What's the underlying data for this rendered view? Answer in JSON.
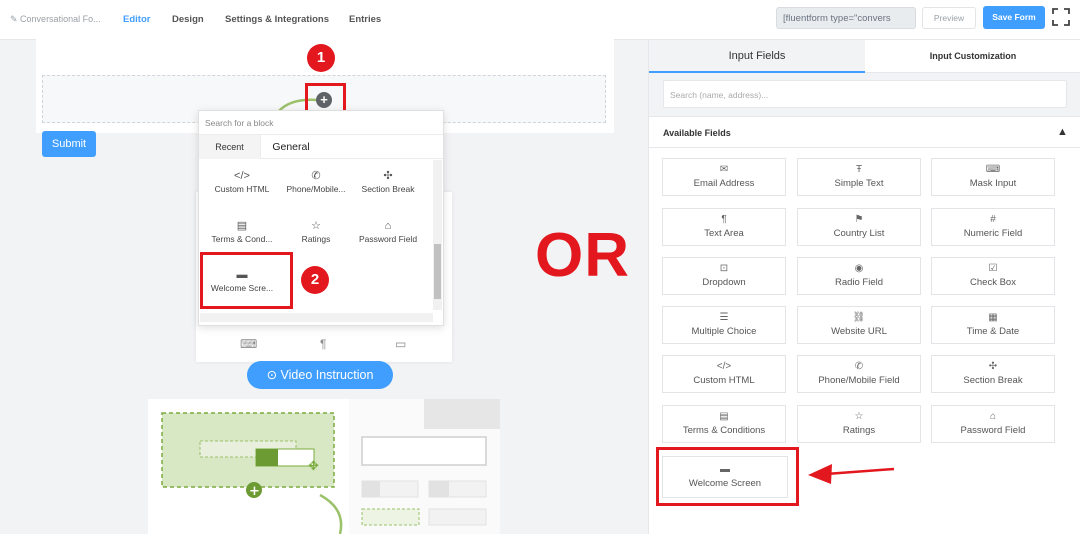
{
  "topbar": {
    "form_name": "Conversational Fo...",
    "tabs": [
      {
        "label": "Editor",
        "active": true
      },
      {
        "label": "Design",
        "active": false
      },
      {
        "label": "Settings & Integrations",
        "active": false
      },
      {
        "label": "Entries",
        "active": false
      }
    ],
    "shortcode": "[fluentform type=\"convers",
    "preview_label": "Preview",
    "save_label": "Save Form"
  },
  "canvas": {
    "submit_label": "Submit",
    "video_label": "Video Instruction",
    "badge_1": "1",
    "badge_2": "2",
    "or_text": "OR"
  },
  "picker": {
    "search_placeholder": "Search for a block",
    "tab_recent": "Recent",
    "tab_general": "General",
    "items": [
      {
        "label": "Custom HTML",
        "icon": "code-icon"
      },
      {
        "label": "Phone/Mobile...",
        "icon": "phone-icon"
      },
      {
        "label": "Section Break",
        "icon": "puzzle-icon"
      },
      {
        "label": "Terms & Cond...",
        "icon": "document-icon"
      },
      {
        "label": "Ratings",
        "icon": "star-icon"
      },
      {
        "label": "Password Field",
        "icon": "lock-icon"
      },
      {
        "label": "Welcome Scre...",
        "icon": "printer-icon"
      }
    ]
  },
  "panel": {
    "tab_input_fields": "Input Fields",
    "tab_customization": "Input Customization",
    "search_placeholder": "Search (name, address)...",
    "available_label": "Available Fields",
    "fields": [
      {
        "label": "Email Address",
        "icon": "envelope-icon"
      },
      {
        "label": "Simple Text",
        "icon": "text-icon"
      },
      {
        "label": "Mask Input",
        "icon": "keyboard-icon"
      },
      {
        "label": "Text Area",
        "icon": "paragraph-icon"
      },
      {
        "label": "Country List",
        "icon": "flag-icon"
      },
      {
        "label": "Numeric Field",
        "icon": "hash-icon"
      },
      {
        "label": "Dropdown",
        "icon": "dropdown-icon"
      },
      {
        "label": "Radio Field",
        "icon": "radio-icon"
      },
      {
        "label": "Check Box",
        "icon": "checkbox-icon"
      },
      {
        "label": "Multiple Choice",
        "icon": "list-icon"
      },
      {
        "label": "Website URL",
        "icon": "link-icon"
      },
      {
        "label": "Time & Date",
        "icon": "calendar-icon"
      },
      {
        "label": "Custom HTML",
        "icon": "code-icon"
      },
      {
        "label": "Phone/Mobile Field",
        "icon": "phone-icon"
      },
      {
        "label": "Section Break",
        "icon": "puzzle-icon"
      },
      {
        "label": "Terms & Conditions",
        "icon": "document-icon"
      },
      {
        "label": "Ratings",
        "icon": "star-icon"
      },
      {
        "label": "Password Field",
        "icon": "lock-icon"
      },
      {
        "label": "Welcome Screen",
        "icon": "printer-icon"
      }
    ]
  },
  "colors": {
    "accent": "#409eff",
    "highlight_red": "#e3171e",
    "illustration_green": "#7cab3f"
  }
}
